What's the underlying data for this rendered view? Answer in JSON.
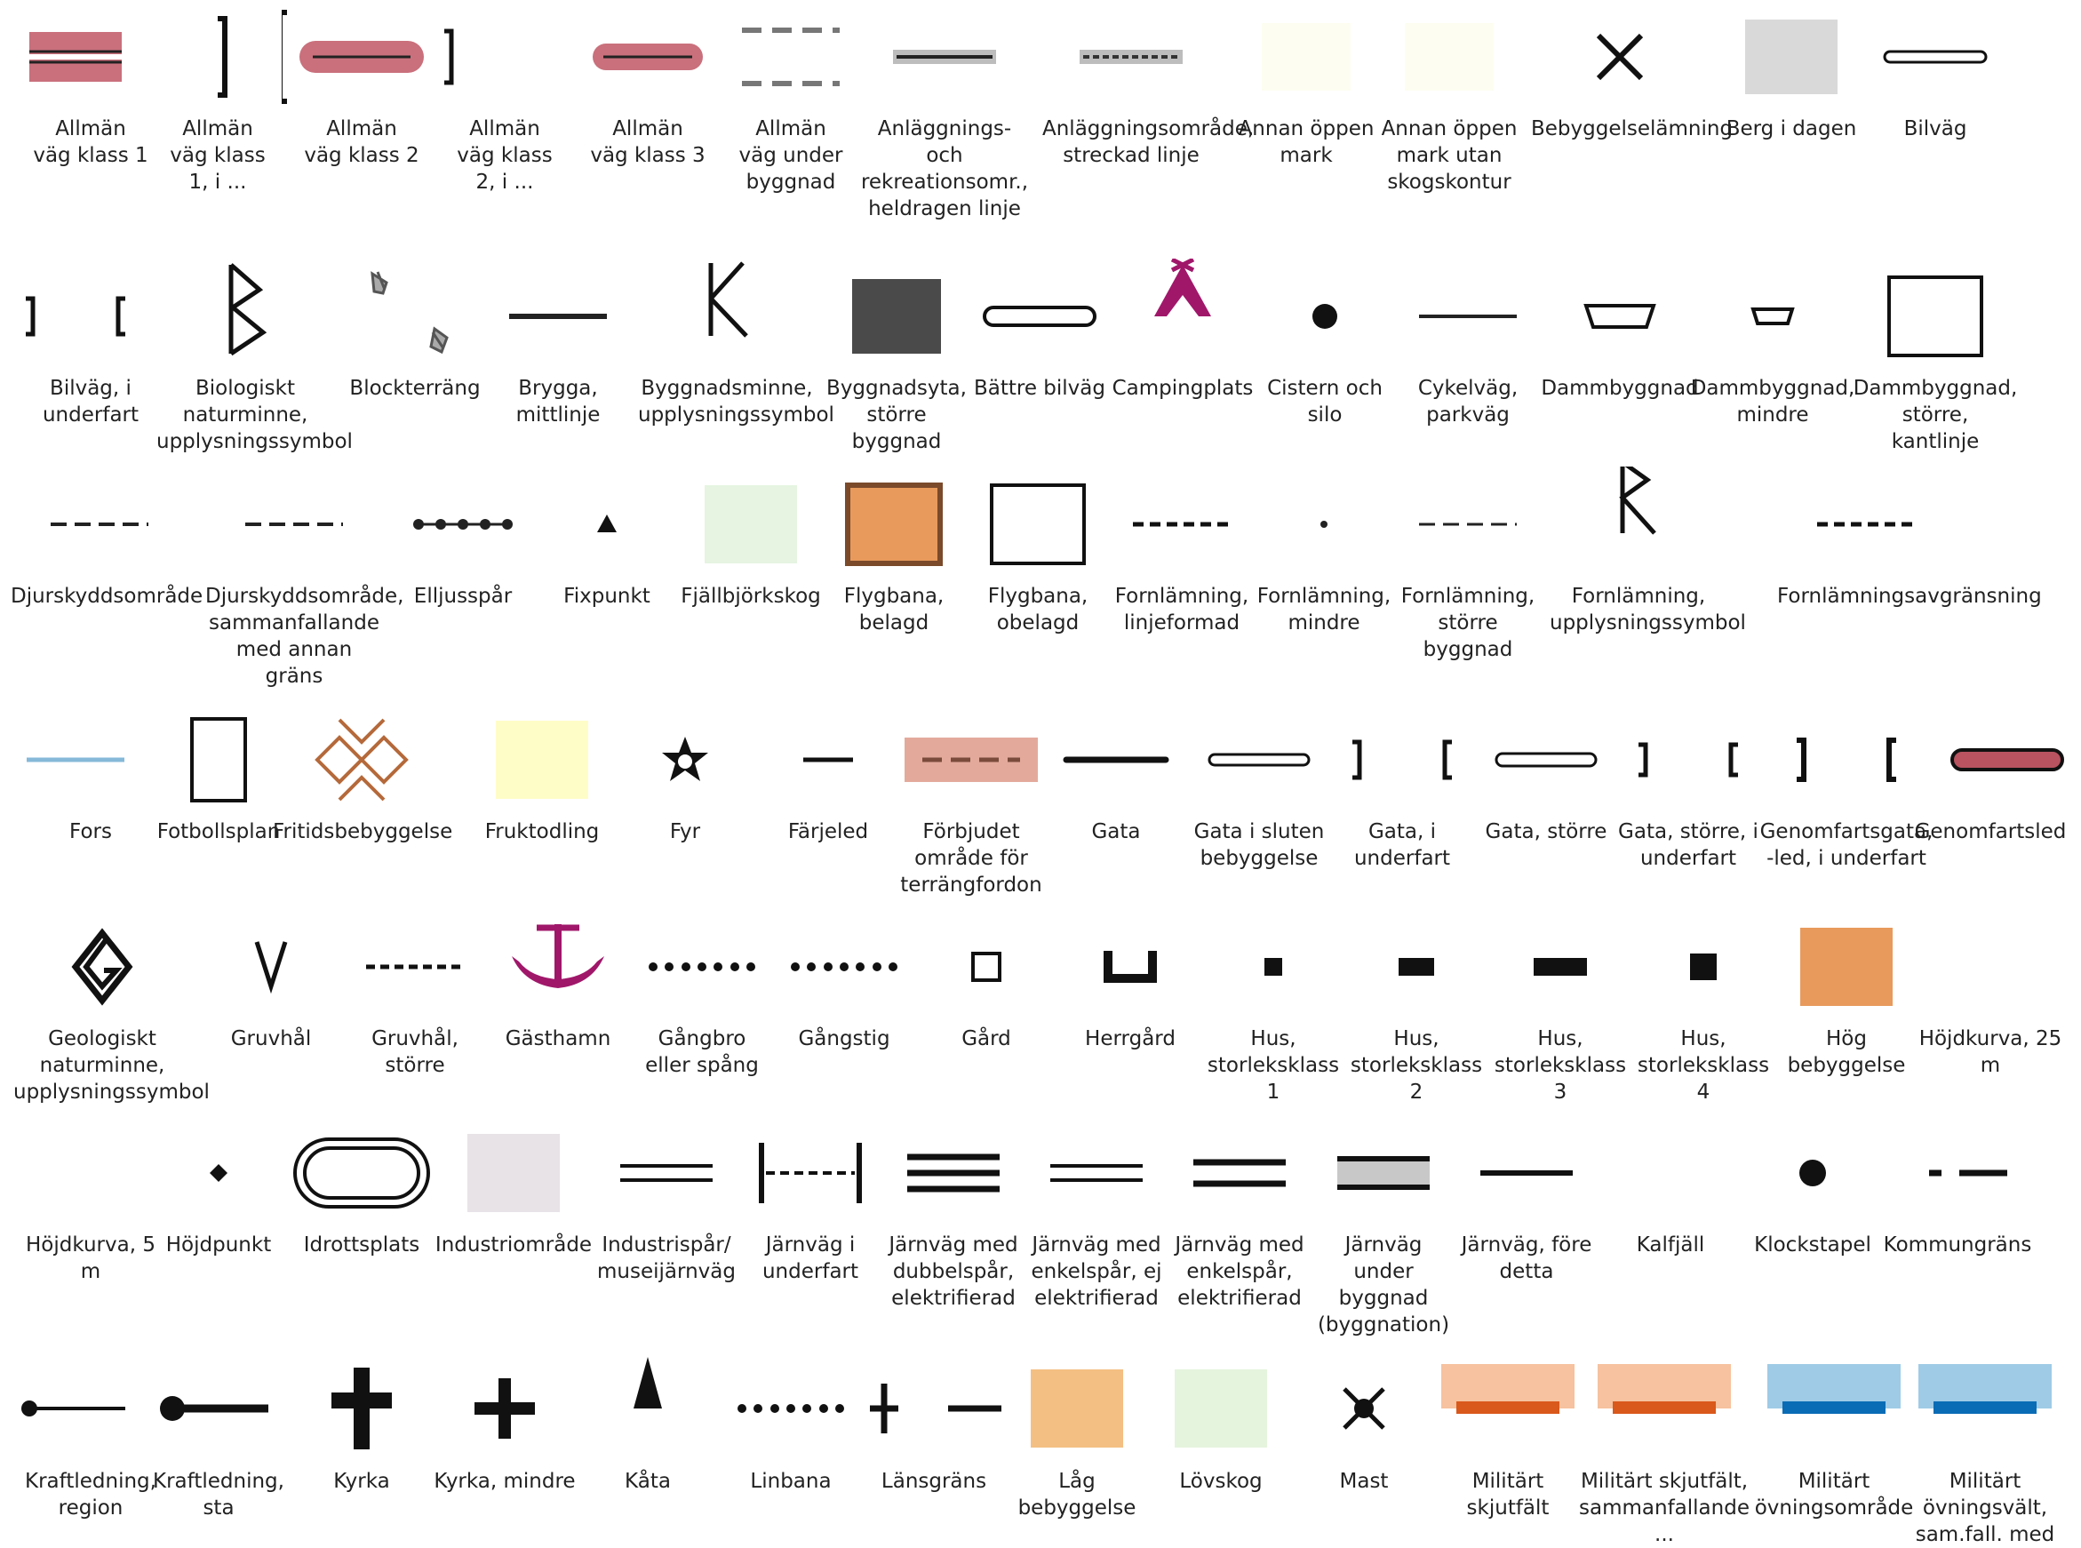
{
  "legend": {
    "items": [
      {
        "id": "allman-vag-klass-1",
        "label": "Allmän\nväg klass 1"
      },
      {
        "id": "allman-vag-klass-1-i",
        "label": "Allmän\nväg klass\n1, i ..."
      },
      {
        "id": "allman-vag-klass-2",
        "label": "Allmän\nväg klass 2"
      },
      {
        "id": "allman-vag-klass-2-i",
        "label": "Allmän\nväg klass\n2, i ..."
      },
      {
        "id": "allman-vag-klass-3",
        "label": "Allmän\nväg klass 3"
      },
      {
        "id": "allman-vag-under-byggnad",
        "label": "Allmän\nväg under\nbyggnad"
      },
      {
        "id": "anlaggnings-rekreation",
        "label": "Anläggnings-\noch\nrekreationsomr.,\nheldragen linje"
      },
      {
        "id": "anlaggningsomrade-streckad",
        "label": "Anläggningsområde,\nstreckad linje"
      },
      {
        "id": "annan-oppen-mark",
        "label": "Annan öppen\nmark"
      },
      {
        "id": "annan-oppen-mark-utan-skogskontur",
        "label": "Annan öppen\nmark utan\nskogskontur"
      },
      {
        "id": "bebyggelselamning",
        "label": "Bebyggelselämning"
      },
      {
        "id": "berg-i-dagen",
        "label": "Berg i dagen"
      },
      {
        "id": "bilvag",
        "label": "Bilväg"
      },
      {
        "id": "bilvag-i-underfart",
        "label": "Bilväg, i\nunderfart"
      },
      {
        "id": "biologiskt-naturminne",
        "label": "Biologiskt\nnaturminne,\nupplysningssymbol"
      },
      {
        "id": "blockterrang",
        "label": "Blockterräng"
      },
      {
        "id": "brygga-mittlinje",
        "label": "Brygga,\nmittlinje"
      },
      {
        "id": "byggnadsminne",
        "label": "Byggnadsminne,\nupplysningssymbol"
      },
      {
        "id": "byggnadsyta-storre",
        "label": "Byggnadsyta,\nstörre\nbyggnad"
      },
      {
        "id": "battre-bilvag",
        "label": "Bättre bilväg"
      },
      {
        "id": "campingplats",
        "label": "Campingplats"
      },
      {
        "id": "cistern-och-silo",
        "label": "Cistern och\nsilo"
      },
      {
        "id": "cykelvag-parkvag",
        "label": "Cykelväg,\nparkväg"
      },
      {
        "id": "dammbyggnad",
        "label": "Dammbyggnad"
      },
      {
        "id": "dammbyggnad-mindre",
        "label": "Dammbyggnad,\nmindre"
      },
      {
        "id": "dammbyggnad-storre-kantlinje",
        "label": "Dammbyggnad,\nstörre,\nkantlinje"
      },
      {
        "id": "djurskyddsomrade",
        "label": "Djurskyddsområde"
      },
      {
        "id": "djurskyddsomrade-sammanfallande",
        "label": "Djurskyddsområde,\nsammanfallande\nmed annan gräns"
      },
      {
        "id": "elljusspar",
        "label": "Elljusspår"
      },
      {
        "id": "fixpunkt",
        "label": "Fixpunkt"
      },
      {
        "id": "fjallbjorkskog",
        "label": "Fjällbjörkskog"
      },
      {
        "id": "flygbana-belagd",
        "label": "Flygbana,\nbelagd"
      },
      {
        "id": "flygbana-obelagd",
        "label": "Flygbana,\nobelagd"
      },
      {
        "id": "fornlamning-linjeformad",
        "label": "Fornlämning,\nlinjeformad"
      },
      {
        "id": "fornlamning-mindre",
        "label": "Fornlämning,\nmindre"
      },
      {
        "id": "fornlamning-storre-byggnad",
        "label": "Fornlämning,\nstörre\nbyggnad"
      },
      {
        "id": "fornlamning-upplysningssymbol",
        "label": "Fornlämning,\nupplysningssymbol"
      },
      {
        "id": "fornlamningsavgransning",
        "label": "Fornlämningsavgränsning"
      },
      {
        "id": "fors",
        "label": "Fors"
      },
      {
        "id": "fotbollsplan",
        "label": "Fotbollsplan"
      },
      {
        "id": "fritidsbebyggelse",
        "label": "Fritidsbebyggelse"
      },
      {
        "id": "fruktodling",
        "label": "Fruktodling"
      },
      {
        "id": "fyr",
        "label": "Fyr"
      },
      {
        "id": "farjeled",
        "label": "Färjeled"
      },
      {
        "id": "forbjudet-omrade",
        "label": "Förbjudet\nområde för\nterrängfordon"
      },
      {
        "id": "gata",
        "label": "Gata"
      },
      {
        "id": "gata-i-sluten-bebyggelse",
        "label": "Gata i sluten\nbebyggelse"
      },
      {
        "id": "gata-i-underfart",
        "label": "Gata, i\nunderfart"
      },
      {
        "id": "gata-storre",
        "label": "Gata, större"
      },
      {
        "id": "gata-storre-i-underfart",
        "label": "Gata, större, i\nunderfart"
      },
      {
        "id": "genomfartsgata-i-underfart",
        "label": "Genomfartsgata,\n-led, i underfart"
      },
      {
        "id": "genomfartsled",
        "label": "Genomfartsled"
      },
      {
        "id": "geologiskt-naturminne",
        "label": "Geologiskt\nnaturminne,\nupplysningssymbol"
      },
      {
        "id": "gruvhal",
        "label": "Gruvhål"
      },
      {
        "id": "gruvhal-storre",
        "label": "Gruvhål,\nstörre"
      },
      {
        "id": "gasthamn",
        "label": "Gästhamn"
      },
      {
        "id": "gangbro-eller-spang",
        "label": "Gångbro\neller spång"
      },
      {
        "id": "gangstig",
        "label": "Gångstig"
      },
      {
        "id": "gard",
        "label": "Gård"
      },
      {
        "id": "herrgard",
        "label": "Herrgård"
      },
      {
        "id": "hus-storleksklass-1",
        "label": "Hus,\nstorleksklass\n1"
      },
      {
        "id": "hus-storleksklass-2",
        "label": "Hus,\nstorleksklass\n2"
      },
      {
        "id": "hus-storleksklass-3",
        "label": "Hus,\nstorleksklass\n3"
      },
      {
        "id": "hus-storleksklass-4",
        "label": "Hus,\nstorleksklass\n4"
      },
      {
        "id": "hog-bebyggelse",
        "label": "Hög\nbebyggelse"
      },
      {
        "id": "hojdkurva-25",
        "label": "Höjdkurva, 25\nm"
      },
      {
        "id": "hojdkurva-5",
        "label": "Höjdkurva, 5\nm"
      },
      {
        "id": "hojdpunkt",
        "label": "Höjdpunkt"
      },
      {
        "id": "idrottsplats",
        "label": "Idrottsplats"
      },
      {
        "id": "industriomrade",
        "label": "Industriområde"
      },
      {
        "id": "industrispar",
        "label": "Industrispår/\nmuseijärnväg"
      },
      {
        "id": "jarnvag-i-underfart",
        "label": "Järnväg i\nunderfart"
      },
      {
        "id": "jarnvag-dubbelspar",
        "label": "Järnväg med\ndubbelspår,\nelektrifierad"
      },
      {
        "id": "jarnvag-enkelspar-ej",
        "label": "Järnväg med\nenkelspår, ej\nelektrifierad"
      },
      {
        "id": "jarnvag-enkelspar",
        "label": "Järnväg med\nenkelspår,\nelektrifierad"
      },
      {
        "id": "jarnvag-under-byggnad",
        "label": "Järnväg\nunder\nbyggnad\n(byggnation)"
      },
      {
        "id": "jarnvag-fore-detta",
        "label": "Järnväg, före\ndetta"
      },
      {
        "id": "kalfjall",
        "label": "Kalfjäll"
      },
      {
        "id": "klockstapel",
        "label": "Klockstapel"
      },
      {
        "id": "kommungrans",
        "label": "Kommungräns"
      },
      {
        "id": "kraftledning-region",
        "label": "Kraftledning,\nregion"
      },
      {
        "id": "kraftledning-sta",
        "label": "Kraftledning,\nsta"
      },
      {
        "id": "kyrka",
        "label": "Kyrka"
      },
      {
        "id": "kyrka-mindre",
        "label": "Kyrka, mindre"
      },
      {
        "id": "kata",
        "label": "Kåta"
      },
      {
        "id": "linbana",
        "label": "Linbana"
      },
      {
        "id": "lansgrans",
        "label": "Länsgräns"
      },
      {
        "id": "lag-bebyggelse",
        "label": "Låg\nbebyggelse"
      },
      {
        "id": "lovskog",
        "label": "Lövskog"
      },
      {
        "id": "mast",
        "label": "Mast"
      },
      {
        "id": "militart-skjutfalt",
        "label": "Militärt\nskjutfält"
      },
      {
        "id": "militart-skjutfalt-sammanfallande",
        "label": "Militärt skjutfält,\nsammanfallande\n..."
      },
      {
        "id": "militart-ovningsomrade",
        "label": "Militärt\növningsområde"
      },
      {
        "id": "militart-ovningsvalt",
        "label": "Militärt\növningsvält,\nsam.fall. med"
      }
    ]
  }
}
